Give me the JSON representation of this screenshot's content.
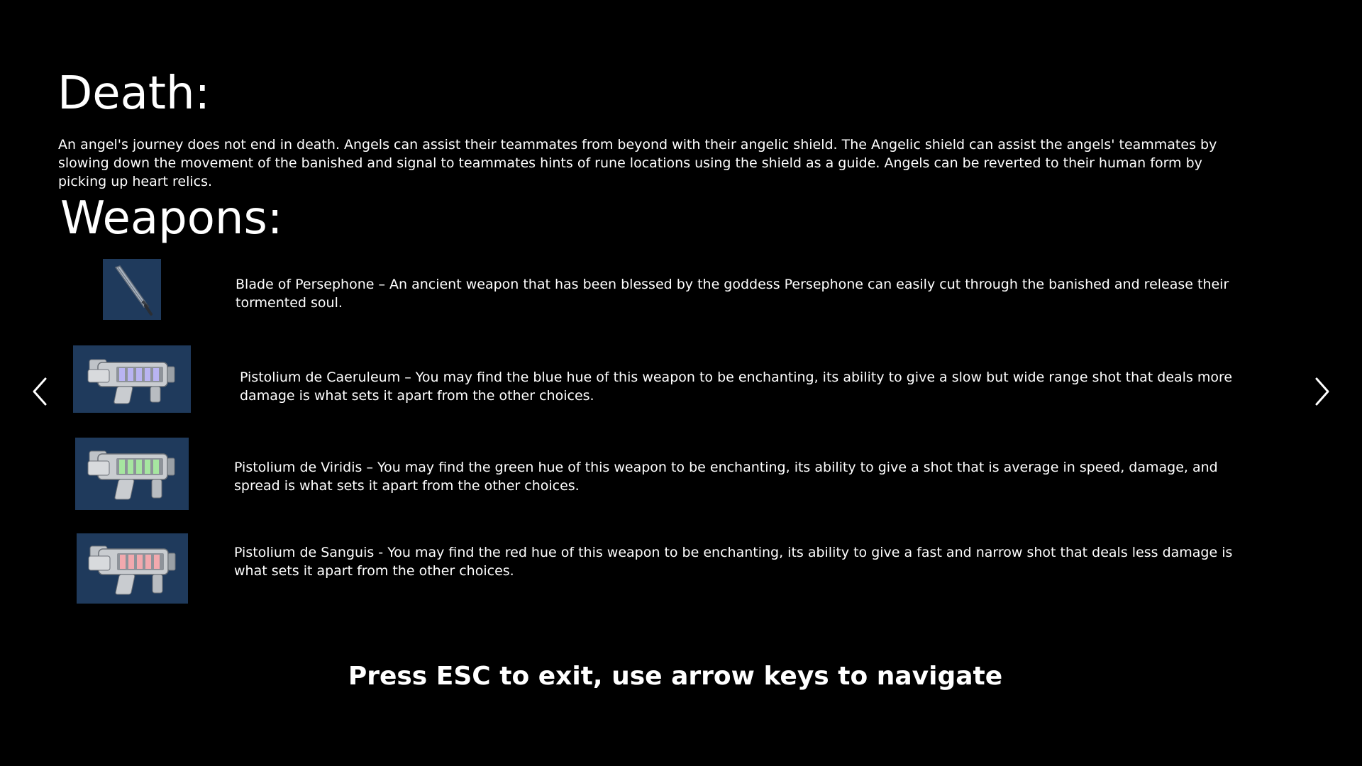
{
  "death": {
    "title": "Death:",
    "body": "An angel's journey does not end in death. Angels can assist their teammates from beyond with their angelic shield. The Angelic shield can assist the angels' teammates by\n slowing down the movement of the banished and signal to teammates hints of rune locations using the shield as a guide. Angels can be reverted to their human form by\n picking up heart relics."
  },
  "weapons": {
    "title": "Weapons:",
    "items": [
      {
        "icon": "blade-icon",
        "description": "Blade of Persephone – An ancient weapon that has been blessed by the goddess Persephone can easily cut through the banished and release their\n tormented soul."
      },
      {
        "icon": "blue-pistol-icon",
        "cell_color": "#b9b4f2",
        "description": "Pistolium de Caeruleum – You may find the blue hue of this weapon to be enchanting, its ability to give a slow but wide range shot that deals more\ndamage is what sets it apart from the other choices."
      },
      {
        "icon": "green-pistol-icon",
        "cell_color": "#a6e6a0",
        "description": "Pistolium de Viridis – You may find the green hue of this weapon to be enchanting, its ability to give a shot that is average in speed, damage, and\nspread is what sets it apart from the other choices."
      },
      {
        "icon": "red-pistol-icon",
        "cell_color": "#f2a9ae",
        "description": "Pistolium de Sanguis - You may find the red hue of this weapon to be enchanting, its ability to give a fast and narrow shot that deals less damage is\nwhat sets it apart from the other choices."
      }
    ]
  },
  "navigation": {
    "left_icon": "chevron-left-icon",
    "right_icon": "chevron-right-icon"
  },
  "footer": {
    "hint": "Press ESC to exit, use arrow keys to navigate"
  },
  "colors": {
    "background": "#000000",
    "text": "#ffffff",
    "icon_background": "#1f3a5c"
  }
}
